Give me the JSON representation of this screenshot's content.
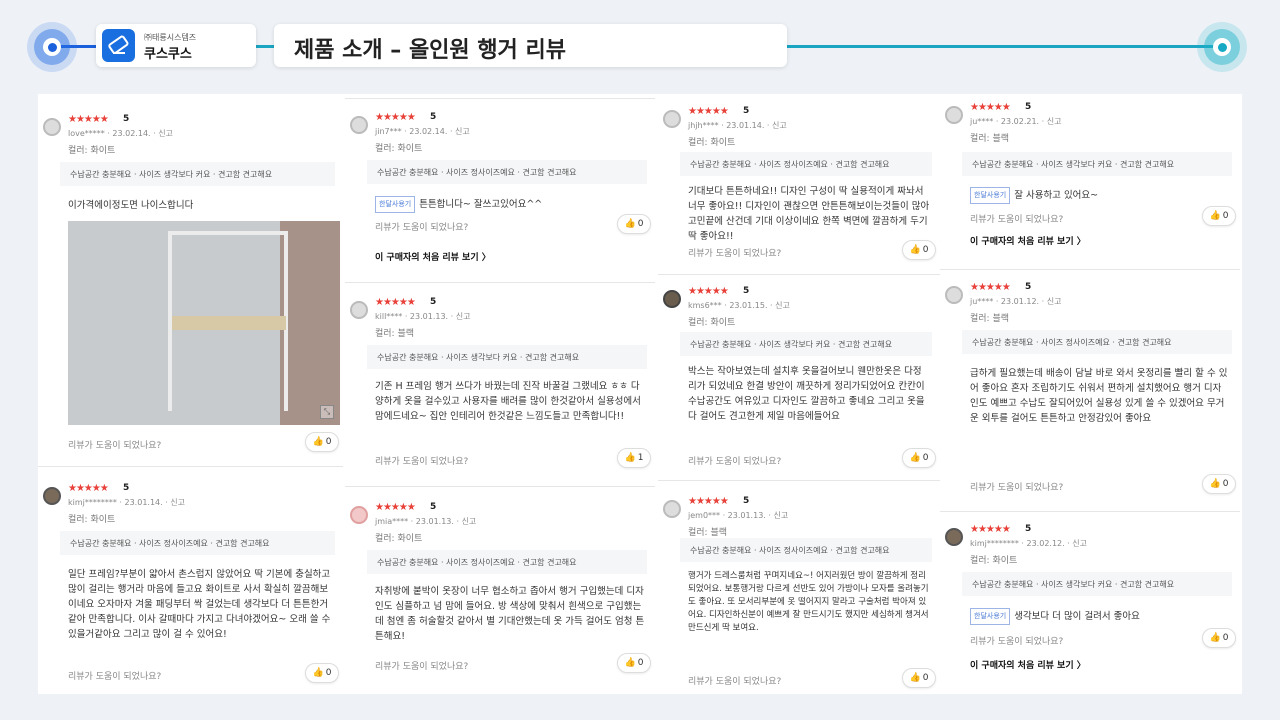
{
  "header": {
    "company_sub": "㈜태룡시스템즈",
    "company_name": "쿠스쿠스",
    "title": "제품 소개 – 올인원 행거 리뷰"
  },
  "common": {
    "helpful": "리뷰가 도움이 되었나요?",
    "first_review": "이 구매자의 처음 리뷰 보기 〉",
    "badge": "한달사용기",
    "stars": "★★★★★"
  },
  "columns": [
    {
      "reviews": [
        {
          "score": "5",
          "meta": "love***** · 23.02.14. · 신고",
          "option": "컬러: 화이트",
          "tags": "수납공간 충분해요 · 사이즈 생각보다 커요 · 견고함 견고해요",
          "body": "이가격에이정도면 나이스합니다",
          "likes": "0"
        },
        {
          "score": "5",
          "meta": "kimj******** · 23.01.14. · 신고",
          "option": "컬러: 화이트",
          "tags": "수납공간 충분해요 · 사이즈 정사이즈예요 · 견고함 견고해요",
          "body": "일단 프레임?부분이 얇아서 촌스럽지 않았어요 딱 기본에 충실하고 많이 걸리는 행거라 마음에 들고요 화이트로 사서 확실히 깔끔해보이네요 오자마자 겨울 패딩부터 싹 걸었는데 생각보다 더 튼튼한거같아 만족합니다. 이사 갈때마다 가지고 다녀야겠어요~ 오래 쓸 수 있을거같아요 그리고 많이 걸 수 있어요!",
          "likes": "0"
        }
      ]
    },
    {
      "reviews": [
        {
          "score": "5",
          "meta": "jin7*** · 23.02.14. · 신고",
          "option": "컬러: 화이트",
          "tags": "수납공간 충분해요 · 사이즈 정사이즈예요 · 견고함 견고해요",
          "body": "튼튼합니다~ 잘쓰고있어요^^",
          "likes": "0"
        },
        {
          "score": "5",
          "meta": "kill**** · 23.01.13. · 신고",
          "option": "컬러: 블랙",
          "tags": "수납공간 충분해요 · 사이즈 생각보다 커요 · 견고함 견고해요",
          "body": "기존 H 프레임 행거 쓰다가 바꿨는데 진작 바꿀걸 그랬네요 ㅎㅎ 다양하게 옷을 걸수있고 사용자를 배려를 많이 한것같아서 실용성에서 맘에드네요~ 집안 인테리어 한것같은 느낌도들고 만족합니다!!",
          "likes": "1"
        },
        {
          "score": "5",
          "meta": "jmia**** · 23.01.13. · 신고",
          "option": "컬러: 화이트",
          "tags": "수납공간 충분해요 · 사이즈 정사이즈예요 · 견고함 견고해요",
          "body": "자취방에 붙박이 옷장이 너무 협소하고 좁아서 행거 구입했는데 디자인도 심플하고 넘 맘에 들어요. 방 색상에 맞춰서 흰색으로 구입했는데 첨엔 좀 허술할것 같아서 별 기대안했는데 옷 가득 걸어도 엄청 튼튼해요!",
          "likes": "0"
        }
      ]
    },
    {
      "reviews": [
        {
          "score": "5",
          "meta": "jhjh**** · 23.01.14. · 신고",
          "option": "컬러: 화이트",
          "tags": "수납공간 충분해요 · 사이즈 정사이즈예요 · 견고함 견고해요",
          "body": "기대보다 튼튼하네요!! 디자인 구성이 딱 실용적이게 짜놔서 너무 좋아요!! 디자인이 괜찮으면 안튼튼해보이는것들이 많아 고민끝에 산건데 기대 이상이네요 한쪽 벽면에 깔끔하게 두기 딱 좋아요!!",
          "likes": "0"
        },
        {
          "score": "5",
          "meta": "kms6*** · 23.01.15. · 신고",
          "option": "컬러: 화이트",
          "tags": "수납공간 충분해요 · 사이즈 생각보다 커요 · 견고함 견고해요",
          "body": "박스는 작아보였는데 설치후 옷을걸어보니 웬만한옷은 다정리가 되었네요 한결 방안이 깨끗하게 정리가되었어요 칸칸이 수납공간도 여유있고 디자인도 깔끔하고 좋네요 그리고 옷을다 걸어도 견고한게 제일 마음에들어요",
          "likes": "0"
        },
        {
          "score": "5",
          "meta": "jem0*** · 23.01.13. · 신고",
          "option": "컬러: 블랙",
          "tags": "수납공간 충분해요 · 사이즈 정사이즈예요 · 견고함 견고해요",
          "body": "행거가 드레스룸처럼 꾸며지네요~! 어지러웠던 방이 깔끔하게 정리되었어요. 보통행거랑 다르게 선반도 있어 가방이나 모자를 올려놓기도 좋아요. 또 모서리부분에 옷 떨어지지 말라고 구술처럼 박아져 있어요. 디자인하신분이 예쁘게 잘 만드시기도 했지만 세심하게 챙겨서 만드신게 딱 보여요.",
          "likes": "0"
        }
      ]
    },
    {
      "reviews": [
        {
          "score": "5",
          "meta": "ju**** · 23.02.21. · 신고",
          "option": "컬러: 블랙",
          "tags": "수납공간 충분해요 · 사이즈 생각보다 커요 · 견고함 견고해요",
          "body": "잘 사용하고 있어요~",
          "likes": "0"
        },
        {
          "score": "5",
          "meta": "ju**** · 23.01.12. · 신고",
          "option": "컬러: 블랙",
          "tags": "수납공간 충분해요 · 사이즈 정사이즈예요 · 견고함 견고해요",
          "body": "급하게 필요했는데 배송이 담날 바로 와서 옷정리를 빨리 할 수 있어 좋아요 혼자 조립하기도 쉬워서 편하게 설치했어요 행거 디자인도 예쁘고 수납도 잘되어있어 실용성 있게 쓸 수 있겠어요 무거운 외투를 걸어도 튼튼하고 안정감있어 좋아요",
          "likes": "0"
        },
        {
          "score": "5",
          "meta": "kimj******** · 23.02.12. · 신고",
          "option": "컬러: 화이트",
          "tags": "수납공간 충분해요 · 사이즈 생각보다 커요 · 견고함 견고해요",
          "body": "생각보다 더 많이 걸려서 좋아요",
          "likes": "0"
        }
      ]
    }
  ]
}
